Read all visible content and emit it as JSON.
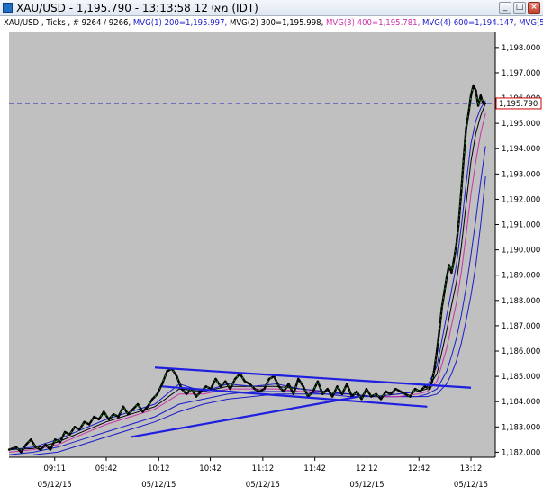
{
  "window": {
    "title": "XAU/USD - 1,195.790 - 13:13:58  12 מאי (IDT)",
    "buttons": {
      "minimize": "_",
      "maximize": "□",
      "close": "×"
    }
  },
  "info_line": {
    "symbol": "XAU/USD , Ticks , ",
    "ticks": "# 9264 / 9266, ",
    "mvg1": "MVG(1) 200=1,195.997, ",
    "mvg2": "MVG(2) 300=1,195.998, ",
    "mvg3": "MVG(3) 400=1,195.781, ",
    "mvg4": "MVG(4) 600=1,194.147, ",
    "mvg5": "MVG(5)",
    "colors": {
      "symbol": "#000000",
      "mvg1": "#1a1acc",
      "mvg2": "#000000",
      "mvg3": "#cc33aa",
      "mvg4": "#1a1acc",
      "mvg5": "#1a1acc"
    }
  },
  "chart_data": {
    "type": "line",
    "ylim": [
      1181.8,
      1198.6
    ],
    "y_ticks": [
      1182,
      1183,
      1184,
      1185,
      1186,
      1187,
      1188,
      1189,
      1190,
      1191,
      1192,
      1193,
      1194,
      1195,
      1196,
      1197,
      1198
    ],
    "y_tick_labels": [
      "1,182.000",
      "1,183.000",
      "1,184.000",
      "1,185.000",
      "1,186.000",
      "1,187.000",
      "1,188.000",
      "1,189.000",
      "1,190.000",
      "1,191.000",
      "1,192.000",
      "1,193.000",
      "1,194.000",
      "1,195.000",
      "1,196.000",
      "1,197.000",
      "1,198.000"
    ],
    "xlim": [
      0,
      100
    ],
    "x_ticks": [
      {
        "x": 9.4,
        "time": "09:11",
        "date": "05/12/15"
      },
      {
        "x": 20.0,
        "time": "09:42",
        "date": ""
      },
      {
        "x": 30.8,
        "time": "10:12",
        "date": "05/12/15"
      },
      {
        "x": 41.4,
        "time": "10:42",
        "date": ""
      },
      {
        "x": 52.2,
        "time": "11:12",
        "date": "05/12/15"
      },
      {
        "x": 62.9,
        "time": "11:42",
        "date": ""
      },
      {
        "x": 73.6,
        "time": "12:12",
        "date": "05/12/15"
      },
      {
        "x": 84.3,
        "time": "12:42",
        "date": ""
      },
      {
        "x": 95.0,
        "time": "13:12",
        "date": "05/12/15"
      }
    ],
    "current_price": 1195.79,
    "current_price_label": "1,195.790",
    "grid": false,
    "colors": {
      "plot_bg": "#c0c0c0",
      "price": "#000000",
      "price_up": "#1f9b1f",
      "mvg1": "#1a1acc",
      "mvg2": "#000000",
      "mvg3": "#cc33aa",
      "mvg4": "#1a1acc",
      "mvg5": "#1a1acc",
      "trendline": "#1f1fe0",
      "price_line": "#2020c0",
      "price_box": "#cc0000"
    },
    "series": [
      {
        "key": "price",
        "x": [
          0,
          1.5,
          2.5,
          3.5,
          4.5,
          5.5,
          6.5,
          7.5,
          8.5,
          9.5,
          10.5,
          11.5,
          12.5,
          13.5,
          14.5,
          15.5,
          16.5,
          17.5,
          18.5,
          19.5,
          20.5,
          21.5,
          22.5,
          23.5,
          24.5,
          25.5,
          26.5,
          27.5,
          28.5,
          29.5,
          30.5,
          31.5,
          32.5,
          33.5,
          34.5,
          35.5,
          36.5,
          37.5,
          38.5,
          39.5,
          40.5,
          41.5,
          42.5,
          43.5,
          44.5,
          45.5,
          46.5,
          47.5,
          48.5,
          49.5,
          50.5,
          51.5,
          52.5,
          53.5,
          54.5,
          55.5,
          56.5,
          57.5,
          58.5,
          59.5,
          60.5,
          61.5,
          62.5,
          63.5,
          64.5,
          65.5,
          66.5,
          67.5,
          68.5,
          69.5,
          70.5,
          71.5,
          72.5,
          73.5,
          74.5,
          75.5,
          76.5,
          77.5,
          78.5,
          79.5,
          80.5,
          81.5,
          82.5,
          83.5,
          84.5,
          85.5,
          86.5,
          87.0,
          87.5,
          88.0,
          88.5,
          89.0,
          89.5,
          90.0,
          90.5,
          91.0,
          91.5,
          92.0,
          92.5,
          93.0,
          93.5,
          94.0,
          94.5,
          95.0,
          95.5,
          96.0,
          96.5,
          97.0,
          97.5,
          98.0
        ],
        "values": [
          1182.1,
          1182.2,
          1182.0,
          1182.3,
          1182.5,
          1182.2,
          1182.1,
          1182.3,
          1182.1,
          1182.5,
          1182.4,
          1182.8,
          1182.7,
          1183.0,
          1182.9,
          1183.2,
          1183.1,
          1183.4,
          1183.3,
          1183.6,
          1183.3,
          1183.5,
          1183.4,
          1183.8,
          1183.5,
          1183.7,
          1183.9,
          1183.6,
          1183.8,
          1184.1,
          1184.3,
          1184.7,
          1185.2,
          1185.3,
          1185.0,
          1184.5,
          1184.3,
          1184.5,
          1184.2,
          1184.4,
          1184.6,
          1184.5,
          1184.9,
          1184.6,
          1184.8,
          1184.5,
          1184.9,
          1185.1,
          1184.8,
          1184.7,
          1184.5,
          1184.4,
          1184.5,
          1184.9,
          1185.0,
          1184.6,
          1184.4,
          1184.7,
          1184.3,
          1184.9,
          1184.6,
          1184.2,
          1184.4,
          1184.8,
          1184.3,
          1184.5,
          1184.2,
          1184.6,
          1184.3,
          1184.7,
          1184.2,
          1184.4,
          1184.1,
          1184.5,
          1184.2,
          1184.3,
          1184.1,
          1184.4,
          1184.3,
          1184.5,
          1184.4,
          1184.3,
          1184.2,
          1184.5,
          1184.4,
          1184.6,
          1184.5,
          1184.8,
          1185.3,
          1186.0,
          1186.8,
          1187.7,
          1188.3,
          1188.9,
          1189.4,
          1189.1,
          1189.6,
          1190.2,
          1191.1,
          1192.3,
          1193.6,
          1194.8,
          1195.4,
          1196.1,
          1196.5,
          1196.3,
          1195.7,
          1196.1,
          1195.8,
          1195.79
        ]
      },
      {
        "key": "mvg1",
        "x": [
          0,
          5,
          10,
          15,
          20,
          25,
          30,
          35,
          40,
          45,
          50,
          55,
          60,
          65,
          70,
          75,
          80,
          84,
          86,
          88,
          90,
          91,
          92,
          93,
          94,
          95,
          96,
          97,
          98
        ],
        "values": [
          1182.1,
          1182.2,
          1182.5,
          1182.9,
          1183.3,
          1183.6,
          1183.9,
          1184.7,
          1184.4,
          1184.7,
          1184.6,
          1184.7,
          1184.5,
          1184.4,
          1184.3,
          1184.2,
          1184.3,
          1184.4,
          1184.6,
          1185.4,
          1187.4,
          1188.4,
          1189.4,
          1190.9,
          1192.6,
          1194.2,
          1195.1,
          1195.6,
          1195.9
        ]
      },
      {
        "key": "mvg2",
        "x": [
          0,
          5,
          10,
          15,
          20,
          25,
          30,
          35,
          40,
          45,
          50,
          55,
          60,
          65,
          70,
          75,
          80,
          84,
          86,
          88,
          90,
          91,
          92,
          93,
          94,
          95,
          96,
          97,
          98
        ],
        "values": [
          1182.1,
          1182.15,
          1182.4,
          1182.8,
          1183.2,
          1183.5,
          1183.8,
          1184.5,
          1184.4,
          1184.6,
          1184.6,
          1184.6,
          1184.5,
          1184.4,
          1184.3,
          1184.2,
          1184.3,
          1184.4,
          1184.5,
          1185.1,
          1186.8,
          1187.8,
          1188.7,
          1190.1,
          1191.8,
          1193.5,
          1194.6,
          1195.3,
          1195.8
        ]
      },
      {
        "key": "mvg3",
        "x": [
          0,
          5,
          10,
          15,
          20,
          25,
          30,
          35,
          40,
          45,
          50,
          55,
          60,
          65,
          70,
          75,
          80,
          84,
          86,
          88,
          90,
          91,
          92,
          93,
          94,
          95,
          96,
          97,
          98
        ],
        "values": [
          1182.0,
          1182.1,
          1182.3,
          1182.7,
          1183.1,
          1183.4,
          1183.7,
          1184.3,
          1184.3,
          1184.5,
          1184.5,
          1184.5,
          1184.4,
          1184.4,
          1184.3,
          1184.2,
          1184.2,
          1184.3,
          1184.4,
          1184.8,
          1186.1,
          1187.0,
          1187.9,
          1189.1,
          1190.6,
          1192.2,
          1193.5,
          1194.6,
          1195.4
        ]
      },
      {
        "key": "mvg4",
        "x": [
          0,
          5,
          10,
          15,
          20,
          25,
          30,
          35,
          40,
          45,
          50,
          55,
          60,
          65,
          70,
          75,
          80,
          84,
          86,
          88,
          90,
          91,
          92,
          93,
          94,
          95,
          96,
          97,
          98
        ],
        "values": [
          1181.9,
          1182.0,
          1182.2,
          1182.5,
          1182.8,
          1183.1,
          1183.4,
          1183.9,
          1184.1,
          1184.3,
          1184.4,
          1184.4,
          1184.4,
          1184.3,
          1184.3,
          1184.2,
          1184.2,
          1184.2,
          1184.3,
          1184.5,
          1185.2,
          1185.8,
          1186.5,
          1187.4,
          1188.5,
          1189.8,
          1191.2,
          1192.7,
          1194.1
        ]
      },
      {
        "key": "mvg5",
        "x": [
          5,
          10,
          15,
          20,
          25,
          30,
          35,
          40,
          45,
          50,
          55,
          60,
          65,
          70,
          75,
          80,
          84,
          86,
          88,
          90,
          91,
          92,
          93,
          94,
          95,
          96,
          97,
          98
        ],
        "values": [
          1181.9,
          1182.0,
          1182.3,
          1182.6,
          1182.9,
          1183.2,
          1183.6,
          1183.9,
          1184.1,
          1184.2,
          1184.3,
          1184.3,
          1184.3,
          1184.2,
          1184.2,
          1184.2,
          1184.2,
          1184.2,
          1184.3,
          1184.7,
          1185.1,
          1185.6,
          1186.3,
          1187.2,
          1188.2,
          1189.4,
          1191.0,
          1192.9
        ]
      }
    ],
    "trendlines": [
      {
        "x1": 30.0,
        "y1": 1185.35,
        "x2": 95.0,
        "y2": 1184.55
      },
      {
        "x1": 31.5,
        "y1": 1184.6,
        "x2": 86.0,
        "y2": 1183.8
      },
      {
        "x1": 25.0,
        "y1": 1182.6,
        "x2": 72.0,
        "y2": 1184.2
      }
    ]
  }
}
